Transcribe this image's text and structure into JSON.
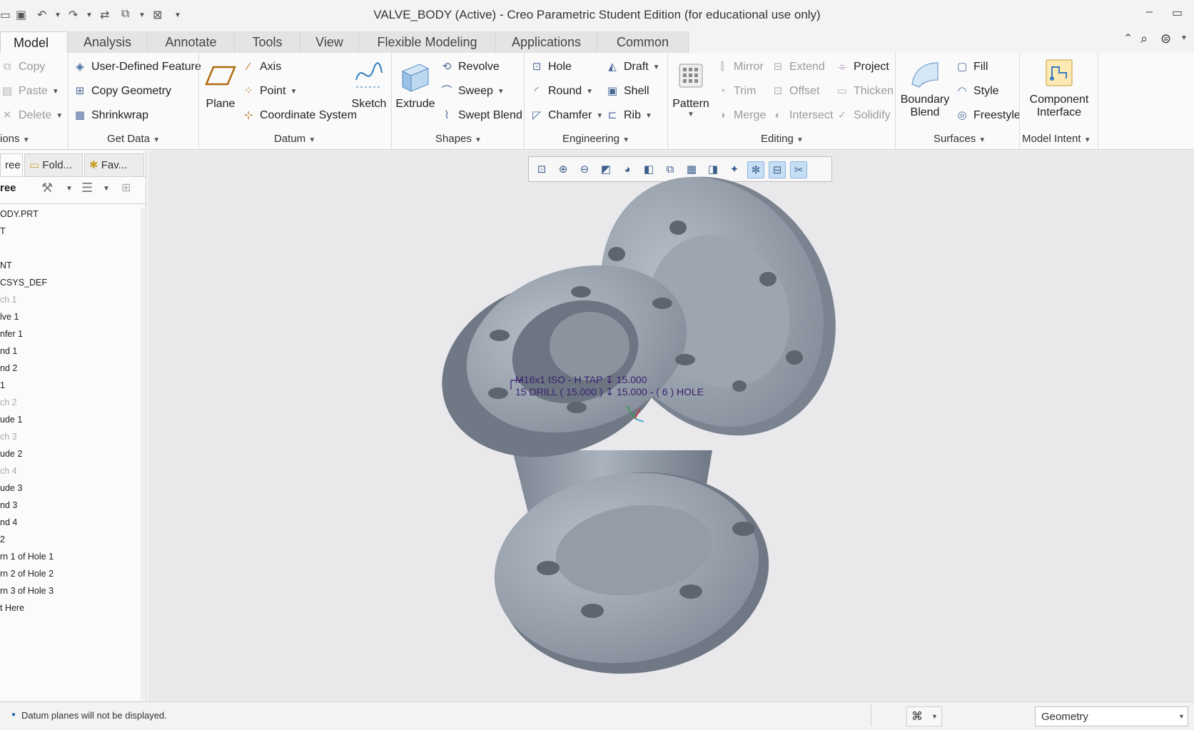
{
  "window": {
    "title": "VALVE_BODY (Active) - Creo Parametric Student Edition (for educational use only)",
    "minimize_icon": "minimize-icon",
    "maximize_icon": "maximize-icon"
  },
  "tabs": [
    {
      "label": "Model",
      "active": true
    },
    {
      "label": "Analysis"
    },
    {
      "label": "Annotate"
    },
    {
      "label": "Tools"
    },
    {
      "label": "View"
    },
    {
      "label": "Flexible Modeling"
    },
    {
      "label": "Applications"
    },
    {
      "label": "Common"
    }
  ],
  "ribbon": {
    "operations": {
      "copy": "Copy",
      "paste": "Paste",
      "delete": "Delete",
      "label": "ions"
    },
    "get_data": {
      "udf": "User-Defined Feature",
      "copy_geometry": "Copy Geometry",
      "shrinkwrap": "Shrinkwrap",
      "label": "Get Data"
    },
    "datum": {
      "plane": "Plane",
      "axis": "Axis",
      "point": "Point",
      "csys": "Coordinate System",
      "sketch": "Sketch",
      "label": "Datum"
    },
    "shapes": {
      "extrude": "Extrude",
      "revolve": "Revolve",
      "sweep": "Sweep",
      "swept_blend": "Swept Blend",
      "label": "Shapes"
    },
    "engineering": {
      "hole": "Hole",
      "round": "Round",
      "chamfer": "Chamfer",
      "draft": "Draft",
      "shell": "Shell",
      "rib": "Rib",
      "label": "Engineering"
    },
    "editing": {
      "pattern": "Pattern",
      "mirror": "Mirror",
      "trim": "Trim",
      "merge": "Merge",
      "extend": "Extend",
      "offset": "Offset",
      "intersect": "Intersect",
      "project": "Project",
      "thicken": "Thicken",
      "solidify": "Solidify",
      "label": "Editing"
    },
    "surfaces": {
      "boundary_blend_1": "Boundary",
      "boundary_blend_2": "Blend",
      "fill": "Fill",
      "style": "Style",
      "freestyle": "Freestyle",
      "label": "Surfaces"
    },
    "model_intent": {
      "component_interface_1": "Component",
      "component_interface_2": "Interface",
      "label": "Model Intent"
    }
  },
  "left_panel": {
    "tabs": [
      {
        "label": "ree"
      },
      {
        "label": "Fold..."
      },
      {
        "label": "Fav..."
      }
    ],
    "tree_header": "ree",
    "tree_items": [
      {
        "label": "ODY.PRT",
        "dim": false
      },
      {
        "label": "T",
        "dim": false
      },
      {
        "label": "",
        "dim": false
      },
      {
        "label": "NT",
        "dim": false
      },
      {
        "label": "CSYS_DEF",
        "dim": false
      },
      {
        "label": "ch 1",
        "dim": true
      },
      {
        "label": "lve 1",
        "dim": false
      },
      {
        "label": "nfer 1",
        "dim": false
      },
      {
        "label": "nd 1",
        "dim": false
      },
      {
        "label": "nd 2",
        "dim": false
      },
      {
        "label": "1",
        "dim": false
      },
      {
        "label": "ch 2",
        "dim": true
      },
      {
        "label": "ude 1",
        "dim": false
      },
      {
        "label": "ch 3",
        "dim": true
      },
      {
        "label": "ude 2",
        "dim": false
      },
      {
        "label": "ch 4",
        "dim": true
      },
      {
        "label": "ude 3",
        "dim": false
      },
      {
        "label": "nd 3",
        "dim": false
      },
      {
        "label": "nd 4",
        "dim": false
      },
      {
        "label": "2",
        "dim": false
      },
      {
        "label": "rn 1 of Hole 1",
        "dim": false
      },
      {
        "label": "rn 2 of Hole 2",
        "dim": false
      },
      {
        "label": "rn 3 of Hole 3",
        "dim": false
      },
      {
        "label": "t Here",
        "dim": false
      }
    ]
  },
  "viewport": {
    "annotation_line1": "M16x1 ISO - H TAP ↧ 15.000",
    "annotation_line2": "15 DRILL ( 15.000 ) ↧ 15.000 - ( 6 ) HOLE",
    "model_color": "#9aa3ae"
  },
  "status": {
    "message": "Datum planes will not be displayed.",
    "filter_value": "Geometry"
  }
}
